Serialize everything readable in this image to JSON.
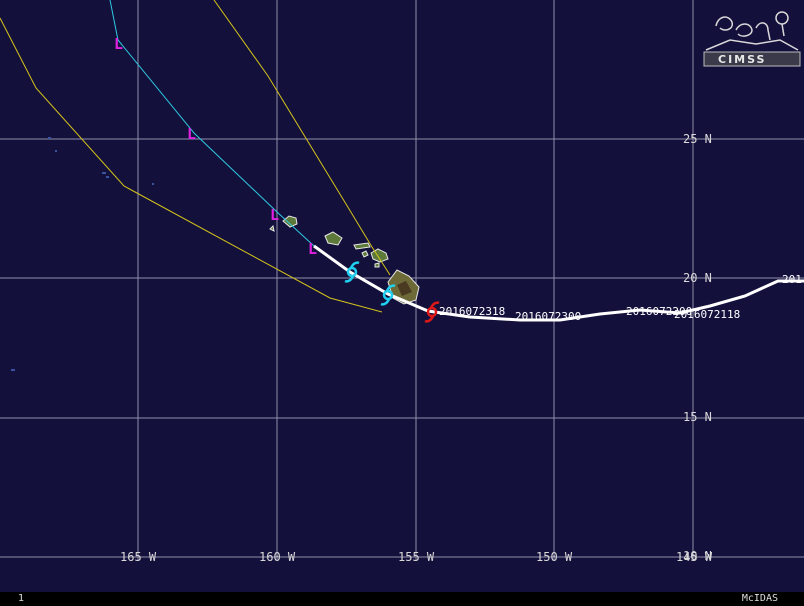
{
  "map": {
    "background": "#14103c",
    "grid_color": "#8f8fa8",
    "cone_color": "#d4c41a",
    "forecast_track_color": "#2fc9e0",
    "best_track_color": "#ffffff",
    "low_marker_color": "#e020e0",
    "current_storm_color": "#e01818",
    "past_storm_color": "#20d0f0",
    "lon_labels": [
      "165 W",
      "160 W",
      "155 W",
      "150 W",
      "145 W"
    ],
    "lat_labels": [
      "25 N",
      "20 N",
      "15 N",
      "10 N"
    ],
    "track_labels": [
      "2016072318",
      "2016072300",
      "2016072200",
      "2016072118",
      "201"
    ],
    "low_marker": "L",
    "logo_text": "CIMSS",
    "logo_icon": "cimss-logo-icon"
  },
  "status": {
    "left": "1",
    "right": "McIDAS"
  }
}
